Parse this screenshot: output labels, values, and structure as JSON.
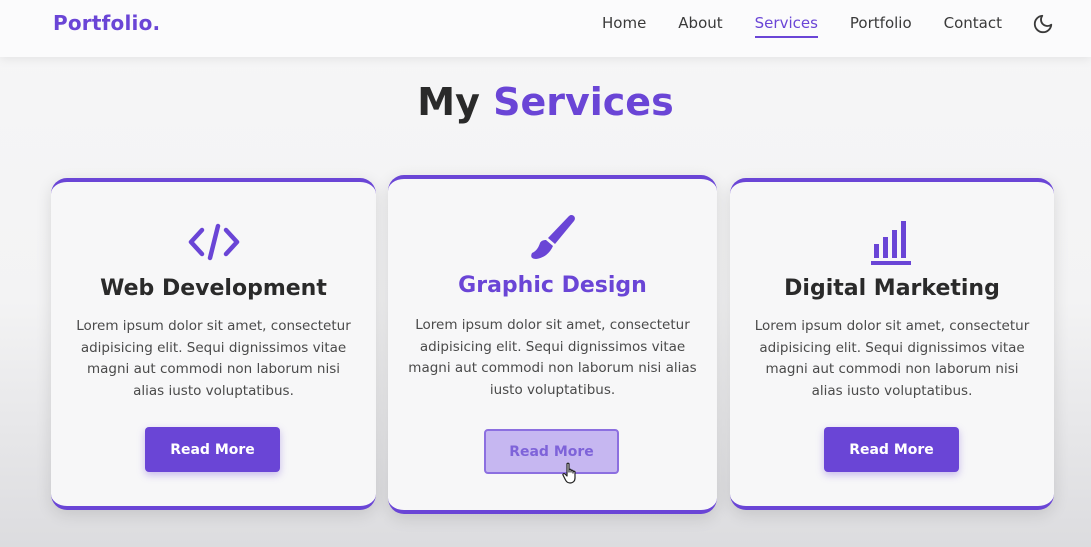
{
  "nav": {
    "logo": "Portfolio.",
    "links": [
      {
        "label": "Home"
      },
      {
        "label": "About"
      },
      {
        "label": "Services"
      },
      {
        "label": "Portfolio"
      },
      {
        "label": "Contact"
      }
    ],
    "active": "Services",
    "theme_icon": "moon-icon"
  },
  "section": {
    "title_prefix": "My",
    "title_accent": "Services"
  },
  "cards": [
    {
      "icon": "code-icon",
      "title": "Web Development",
      "description": "Lorem ipsum dolor sit amet, consectetur adipisicing elit. Sequi dignissimos vitae magni aut commodi non laborum nisi alias iusto voluptatibus.",
      "button": "Read More"
    },
    {
      "icon": "paintbrush-icon",
      "title": "Graphic Design",
      "description": "Lorem ipsum dolor sit amet, consectetur adipisicing elit. Sequi dignissimos vitae magni aut commodi non laborum nisi alias iusto voluptatibus.",
      "button": "Read More"
    },
    {
      "icon": "chart-bars-icon",
      "title": "Digital Marketing",
      "description": "Lorem ipsum dolor sit amet, consectetur adipisicing elit. Sequi dignissimos vitae magni aut commodi non laborum nisi alias iusto voluptatibus.",
      "button": "Read More"
    }
  ],
  "colors": {
    "accent": "#6a45d6",
    "button_hover": "#c6b7f1"
  }
}
